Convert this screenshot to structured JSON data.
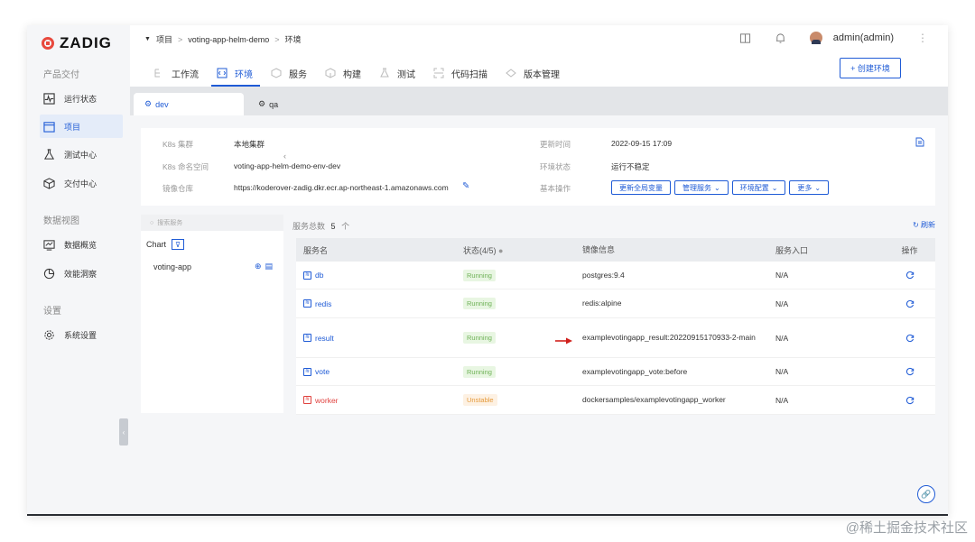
{
  "brand": {
    "logo_text": "ZADIG"
  },
  "sidebar": {
    "sections": [
      {
        "label": "产品交付"
      },
      {
        "label": "数据视图"
      },
      {
        "label": "设置"
      }
    ],
    "items": [
      {
        "label": "运行状态",
        "icon": "pulse-icon"
      },
      {
        "label": "项目",
        "icon": "project-icon",
        "active": true
      },
      {
        "label": "测试中心",
        "icon": "flask-icon"
      },
      {
        "label": "交付中心",
        "icon": "package-icon"
      },
      {
        "label": "数据概览",
        "icon": "dashboard-icon"
      },
      {
        "label": "效能洞察",
        "icon": "pie-icon"
      },
      {
        "label": "系统设置",
        "icon": "gear-icon"
      }
    ]
  },
  "breadcrumb": {
    "items": [
      "项目",
      "voting-app-helm-demo",
      "环境"
    ]
  },
  "header": {
    "user": "admin(admin)"
  },
  "tabs": [
    {
      "label": "工作流",
      "icon": "workflow-icon"
    },
    {
      "label": "环境",
      "icon": "env-icon",
      "active": true
    },
    {
      "label": "服务",
      "icon": "service-icon"
    },
    {
      "label": "构建",
      "icon": "build-icon"
    },
    {
      "label": "测试",
      "icon": "test-icon"
    },
    {
      "label": "代码扫描",
      "icon": "scan-icon"
    },
    {
      "label": "版本管理",
      "icon": "version-icon"
    }
  ],
  "create_env_button": "+ 创建环境",
  "env_tabs": [
    {
      "label": "dev",
      "active": true
    },
    {
      "label": "qa"
    }
  ],
  "info": {
    "k8s_cluster_label": "K8s 集群",
    "k8s_cluster_value": "本地集群",
    "k8s_namespace_label": "K8s 命名空间",
    "k8s_namespace_value": "voting-app-helm-demo-env-dev",
    "registry_label": "镜像仓库",
    "registry_value": "https://koderover-zadig.dkr.ecr.ap-northeast-1.amazonaws.com",
    "update_time_label": "更新时间",
    "update_time_value": "2022-09-15 17:09",
    "env_status_label": "环境状态",
    "env_status_value": "运行不稳定",
    "basic_ops_label": "基本操作",
    "ops": [
      "更新全局变量",
      "管理服务",
      "环境配置",
      "更多"
    ]
  },
  "left_panel": {
    "search_placeholder": "搜索服务",
    "chart_label": "Chart",
    "app_name": "voting-app"
  },
  "service_total_label": "服务总数",
  "service_total_value": "5",
  "service_total_unit": "个",
  "refresh_label": "刷新",
  "table": {
    "headers": [
      "服务名",
      "状态(4/5)",
      "镜像信息",
      "服务入口",
      "操作"
    ],
    "rows": [
      {
        "name": "db",
        "status": "Running",
        "image": "postgres:9.4",
        "entry": "N/A"
      },
      {
        "name": "redis",
        "status": "Running",
        "image": "redis:alpine",
        "entry": "N/A"
      },
      {
        "name": "result",
        "status": "Running",
        "image": "examplevotingapp_result:20220915170933-2-main",
        "entry": "N/A"
      },
      {
        "name": "vote",
        "status": "Running",
        "image": "examplevotingapp_vote:before",
        "entry": "N/A"
      },
      {
        "name": "worker",
        "status": "Unstable",
        "image": "dockersamples/examplevotingapp_worker",
        "entry": "N/A"
      }
    ]
  },
  "watermark": "@稀土掘金技术社区",
  "colors": {
    "accent": "#1f5bd6",
    "brand_red": "#e8493d",
    "running": "#6fb257",
    "unstable": "#e59a3b",
    "error": "#e0413e"
  }
}
